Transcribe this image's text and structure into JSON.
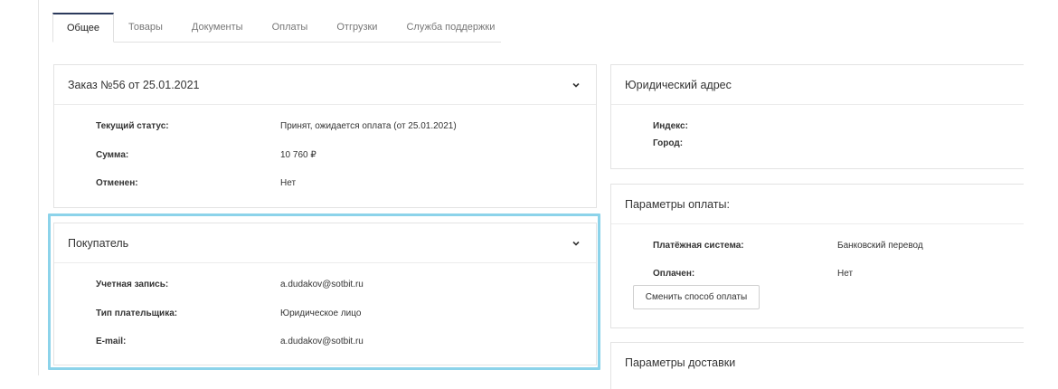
{
  "tabs": [
    {
      "label": "Общее",
      "active": true
    },
    {
      "label": "Товары"
    },
    {
      "label": "Документы"
    },
    {
      "label": "Оплаты"
    },
    {
      "label": "Отгрузки"
    },
    {
      "label": "Служба поддержки"
    }
  ],
  "order": {
    "title": "Заказ №56 от 25.01.2021",
    "rows": [
      {
        "label": "Текущий статус:",
        "value": "Принят, ожидается оплата (от 25.01.2021)"
      },
      {
        "label": "Сумма:",
        "value": "10 760 ₽"
      },
      {
        "label": "Отменен:",
        "value": "Нет"
      }
    ]
  },
  "buyer": {
    "title": "Покупатель",
    "rows": [
      {
        "label": "Учетная запись:",
        "value": "a.dudakov@sotbit.ru"
      },
      {
        "label": "Тип плательщика:",
        "value": "Юридическое лицо"
      },
      {
        "label": "E-mail:",
        "value": "a.dudakov@sotbit.ru"
      }
    ]
  },
  "legal_address": {
    "title": "Юридический адрес",
    "rows": [
      {
        "label": "Индекс:",
        "value": ""
      },
      {
        "label": "Город:",
        "value": ""
      }
    ]
  },
  "payment": {
    "title": "Параметры оплаты:",
    "rows": [
      {
        "label": "Платёжная система:",
        "value": "Банковский перевод"
      },
      {
        "label": "Оплачен:",
        "value": "Нет"
      }
    ],
    "change_button": "Сменить способ оплаты"
  },
  "delivery": {
    "title": "Параметры доставки"
  },
  "colors": {
    "accent_tab": "#2b3a5c",
    "selection": "#8cd3ea"
  }
}
